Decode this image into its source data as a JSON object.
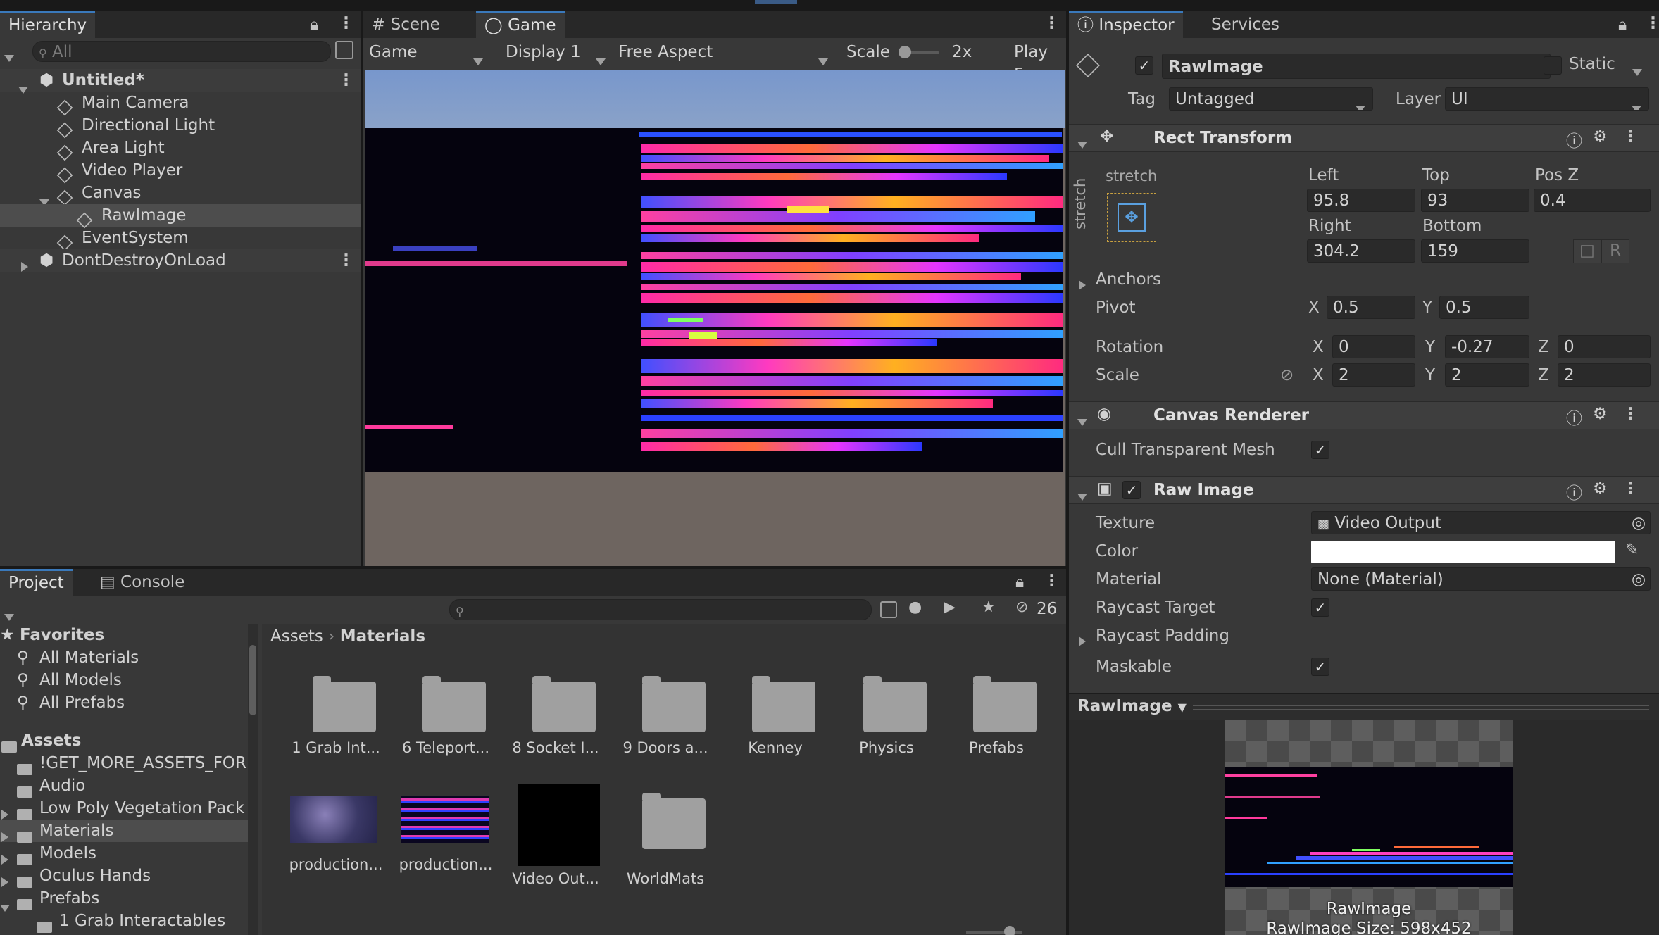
{
  "hierarchy": {
    "tab": "Hierarchy",
    "search_placeholder": "All",
    "items": [
      {
        "label": "Untitled*",
        "kind": "scene"
      },
      {
        "label": "Main Camera"
      },
      {
        "label": "Directional Light"
      },
      {
        "label": "Area Light"
      },
      {
        "label": "Video Player"
      },
      {
        "label": "Canvas"
      },
      {
        "label": "RawImage"
      },
      {
        "label": "EventSystem"
      },
      {
        "label": "DontDestroyOnLoad",
        "kind": "scene"
      }
    ]
  },
  "game": {
    "tabs": [
      "Scene",
      "Game"
    ],
    "toolbar": {
      "view": "Game",
      "display": "Display 1",
      "aspect": "Free Aspect",
      "scale_label": "Scale",
      "scale_value": "2x",
      "play_focused": "Play Fo"
    }
  },
  "inspector": {
    "tabs": [
      "Inspector",
      "Services"
    ],
    "object_name": "RawImage",
    "static_label": "Static",
    "tag_label": "Tag",
    "tag_value": "Untagged",
    "layer_label": "Layer",
    "layer_value": "UI",
    "rect_transform": {
      "title": "Rect Transform",
      "anchor_preset": "stretch",
      "left_label": "Left",
      "left": "95.8",
      "top_label": "Top",
      "top": "93",
      "posz_label": "Pos Z",
      "posz": "0.4",
      "right_label": "Right",
      "right": "304.2",
      "bottom_label": "Bottom",
      "bottom": "159",
      "r_button": "R",
      "anchors_label": "Anchors",
      "pivot_label": "Pivot",
      "pivot_x": "0.5",
      "pivot_y": "0.5",
      "rotation_label": "Rotation",
      "rot_x": "0",
      "rot_y": "-0.27",
      "rot_z": "0",
      "scale_label": "Scale",
      "scale_x": "2",
      "scale_y": "2",
      "scale_z": "2",
      "x": "X",
      "y": "Y",
      "z": "Z"
    },
    "canvas_renderer": {
      "title": "Canvas Renderer",
      "cull_label": "Cull Transparent Mesh"
    },
    "raw_image": {
      "title": "Raw Image",
      "texture_label": "Texture",
      "texture_value": "Video Output",
      "color_label": "Color",
      "material_label": "Material",
      "material_value": "None (Material)",
      "raycast_target_label": "Raycast Target",
      "raycast_padding_label": "Raycast Padding",
      "maskable_label": "Maskable"
    },
    "preview": {
      "title": "RawImage",
      "caption_name": "RawImage",
      "caption_size": "RawImage Size: 598x452"
    }
  },
  "project": {
    "tabs": [
      "Project",
      "Console"
    ],
    "hidden_count": "26",
    "favorites_label": "Favorites",
    "favorites": [
      "All Materials",
      "All Models",
      "All Prefabs"
    ],
    "assets_label": "Assets",
    "asset_folders": [
      "!GET_MORE_ASSETS_FOR",
      "Audio",
      "Low Poly Vegetation Pack",
      "Materials",
      "Models",
      "Oculus Hands",
      "Prefabs",
      "1 Grab Interactables"
    ],
    "breadcrumb": [
      "Assets",
      "Materials"
    ],
    "grid_row1": [
      "1 Grab Int...",
      "6 Teleport...",
      "8 Socket I...",
      "9 Doors a...",
      "Kenney",
      "Physics",
      "Prefabs"
    ],
    "grid_row2": [
      "production...",
      "production...",
      "Video Out...",
      "WorldMats"
    ]
  },
  "colors": {
    "selection": "#4d4d4d",
    "accent": "#3a79bb",
    "panel": "#383838",
    "sky": "#7e99c6",
    "ground": "#6e6560"
  }
}
